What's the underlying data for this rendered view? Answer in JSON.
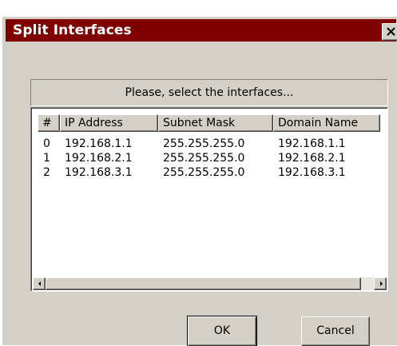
{
  "window": {
    "title": "Split Interfaces",
    "close_icon": "close-icon"
  },
  "panel": {
    "heading": "Please, select the interfaces..."
  },
  "table": {
    "columns": [
      "#",
      "IP Address",
      "Subnet Mask",
      "Domain Name"
    ],
    "rows": [
      [
        "0",
        "192.168.1.1",
        "255.255.255.0",
        "192.168.1.1"
      ],
      [
        "1",
        "192.168.2.1",
        "255.255.255.0",
        "192.168.2.1"
      ],
      [
        "2",
        "192.168.3.1",
        "255.255.255.0",
        "192.168.3.1"
      ]
    ]
  },
  "buttons": {
    "ok": "OK",
    "cancel": "Cancel"
  },
  "colors": {
    "titlebar": "#800000",
    "dialog_face": "#d4d0c8",
    "list_background": "#ffffff"
  }
}
